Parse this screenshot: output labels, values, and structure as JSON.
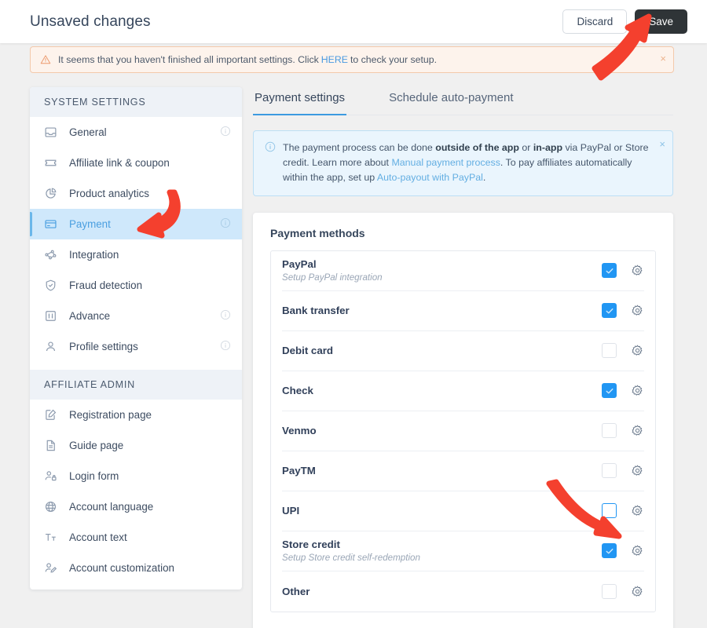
{
  "topbar": {
    "title": "Unsaved changes",
    "discard_label": "Discard",
    "save_label": "Save"
  },
  "warning_banner": {
    "text_before": "It seems that you haven't finished all important settings. Click",
    "link": "HERE",
    "text_after": "to check your setup.",
    "close": "×",
    "border_color": "#f3c9ab",
    "background_color": "#fdf3ec"
  },
  "sidebar": {
    "sections": [
      {
        "title": "SYSTEM SETTINGS",
        "items": [
          {
            "label": "General",
            "icon": "inbox-icon",
            "info": true,
            "active": false
          },
          {
            "label": "Affiliate link & coupon",
            "icon": "coupon-icon",
            "info": false,
            "active": false
          },
          {
            "label": "Product analytics",
            "icon": "pie-chart-icon",
            "info": false,
            "active": false
          },
          {
            "label": "Payment",
            "icon": "credit-card-icon",
            "info": true,
            "active": true
          },
          {
            "label": "Integration",
            "icon": "network-nodes-icon",
            "info": false,
            "active": false
          },
          {
            "label": "Fraud detection",
            "icon": "shield-check-icon",
            "info": false,
            "active": false
          },
          {
            "label": "Advance",
            "icon": "sliders-icon",
            "info": true,
            "active": false
          },
          {
            "label": "Profile settings",
            "icon": "user-icon",
            "info": true,
            "active": false
          }
        ]
      },
      {
        "title": "AFFILIATE ADMIN",
        "items": [
          {
            "label": "Registration page",
            "icon": "form-edit-icon",
            "info": false,
            "active": false
          },
          {
            "label": "Guide page",
            "icon": "document-icon",
            "info": false,
            "active": false
          },
          {
            "label": "Login form",
            "icon": "user-lock-icon",
            "info": false,
            "active": false
          },
          {
            "label": "Account language",
            "icon": "globe-icon",
            "info": false,
            "active": false
          },
          {
            "label": "Account text",
            "icon": "text-size-icon",
            "info": false,
            "active": false
          },
          {
            "label": "Account customization",
            "icon": "user-edit-icon",
            "info": false,
            "active": false
          }
        ]
      }
    ]
  },
  "main": {
    "tabs": [
      {
        "label": "Payment settings",
        "active": true
      },
      {
        "label": "Schedule auto-payment",
        "active": false
      }
    ],
    "info_banner": {
      "part1": "The payment process can be done ",
      "bold1": "outside of the app",
      "part2": " or ",
      "bold2": "in-app",
      "part3": " via PayPal or Store credit. Learn more about ",
      "link1": "Manual payment process",
      "part4": ". To pay affiliates automatically within the app, set up ",
      "link2": "Auto-payout with PayPal",
      "part5": ".",
      "close": "×",
      "background_color": "#eaf5fd",
      "border_color": "#bcdff5"
    },
    "card": {
      "title": "Payment methods",
      "methods": [
        {
          "name": "PayPal",
          "sub": "Setup PayPal integration",
          "checked": true,
          "focused": false
        },
        {
          "name": "Bank transfer",
          "sub": "",
          "checked": true,
          "focused": false
        },
        {
          "name": "Debit card",
          "sub": "",
          "checked": false,
          "focused": false
        },
        {
          "name": "Check",
          "sub": "",
          "checked": true,
          "focused": false
        },
        {
          "name": "Venmo",
          "sub": "",
          "checked": false,
          "focused": false
        },
        {
          "name": "PayTM",
          "sub": "",
          "checked": false,
          "focused": false
        },
        {
          "name": "UPI",
          "sub": "",
          "checked": false,
          "focused": true
        },
        {
          "name": "Store credit",
          "sub": "Setup Store credit self-redemption",
          "checked": true,
          "focused": false
        },
        {
          "name": "Other",
          "sub": "",
          "checked": false,
          "focused": false
        }
      ],
      "settings_icon": "gear-icon"
    }
  },
  "annotations": {
    "arrow_color": "#f4402e",
    "arrows": [
      {
        "name": "arrow-to-save-button"
      },
      {
        "name": "arrow-to-payment-nav-item"
      },
      {
        "name": "arrow-to-store-credit-checkbox"
      }
    ]
  },
  "colors": {
    "accent_blue": "#2196f3",
    "active_nav_bg": "#cfe8fb",
    "page_bg": "#f0f0f0",
    "save_button_bg": "#2f3437"
  }
}
